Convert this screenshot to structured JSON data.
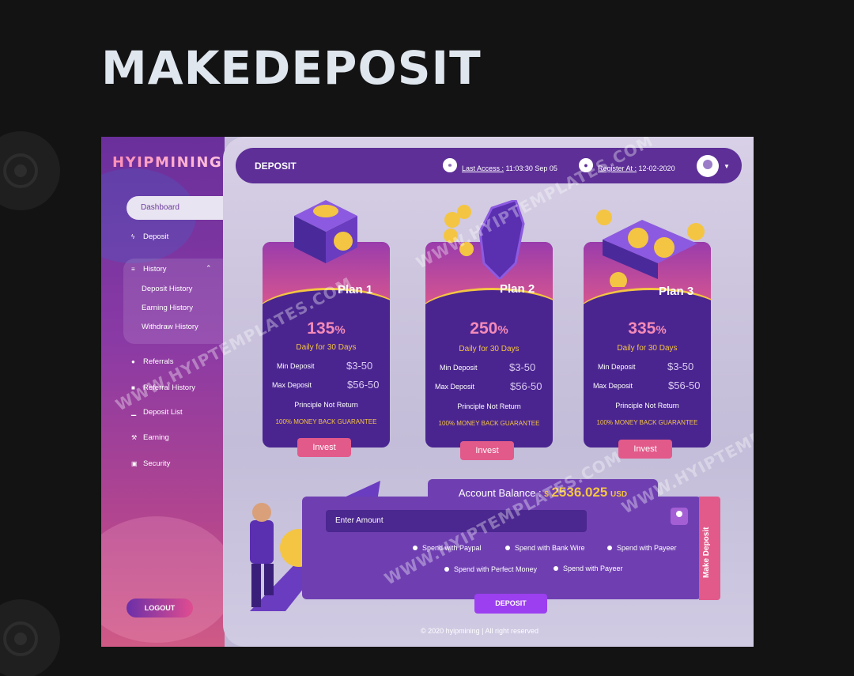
{
  "page": {
    "title": "MAKEDEPOSIT"
  },
  "brand": {
    "logo_text": "HYIPMINING"
  },
  "sidebar": {
    "active_item": "Dashboard",
    "items": [
      {
        "label": "Deposit",
        "icon": "bolt-icon"
      },
      {
        "label": "History",
        "icon": "layers-icon"
      },
      {
        "label": "Referrals",
        "icon": "globe-icon"
      },
      {
        "label": "Referral History",
        "icon": "briefcase-icon"
      },
      {
        "label": "Deposit List",
        "icon": "chart-icon"
      },
      {
        "label": "Earning",
        "icon": "wrench-icon"
      },
      {
        "label": "Security",
        "icon": "lock-icon"
      }
    ],
    "history_sub": [
      "Deposit History",
      "Earning History",
      "Withdraw History"
    ],
    "logout": "LOGOUT"
  },
  "topbar": {
    "title": "DEPOSIT",
    "last_access_label": "Last Access :",
    "last_access_value": " 11:03:30 Sep 05",
    "register_label": "Register At :",
    "register_value": " 12-02-2020"
  },
  "plans": [
    {
      "name": "Plan 1",
      "percent": "135",
      "pct_sign": "%",
      "daily": "Daily for 30 Days",
      "min_label": "Min Deposit",
      "min_value": "$3-50",
      "max_label": "Max Deposit",
      "max_value": "$56-50",
      "principle": "Principle Not Return",
      "guarantee": "100%  MONEY BACK GUARANTEE",
      "invest": "Invest"
    },
    {
      "name": "Plan 2",
      "percent": "250",
      "pct_sign": "%",
      "daily": "Daily for 30 Days",
      "min_label": "Min Deposit",
      "min_value": "$3-50",
      "max_label": "Max Deposit",
      "max_value": "$56-50",
      "principle": "Principle Not Return",
      "guarantee": "100%  MONEY BACK GUARANTEE",
      "invest": "Invest"
    },
    {
      "name": "Plan 3",
      "percent": "335",
      "pct_sign": "%",
      "daily": "Daily for 30 Days",
      "min_label": "Min Deposit",
      "min_value": "$3-50",
      "max_label": "Max Deposit",
      "max_value": "$56-50",
      "principle": "Principle Not Return",
      "guarantee": "100%  MONEY BACK GUARANTEE",
      "invest": "Invest"
    }
  ],
  "deposit": {
    "balance_label": "Account Balance :",
    "currency_symbol": "$",
    "balance": "2536.025",
    "currency": "USD",
    "amount_placeholder": "Enter Amount",
    "options": [
      "Spend with Paypal",
      "Spend with Bank Wire",
      "Spend with Payeer",
      "Spend with Perfect Money",
      "Spend with Payeer"
    ],
    "submit": "DEPOSIT",
    "make_deposit_tab": "Make Deposit"
  },
  "footer": {
    "text": "© 2020 hyipmining  |  All right reserved"
  },
  "watermark": "WWW.HYIPTEMPLATES.COM",
  "colors": {
    "accent": "#5d2f97",
    "pink": "#e25a8a",
    "gold": "#f4c542",
    "background": "#131313"
  }
}
